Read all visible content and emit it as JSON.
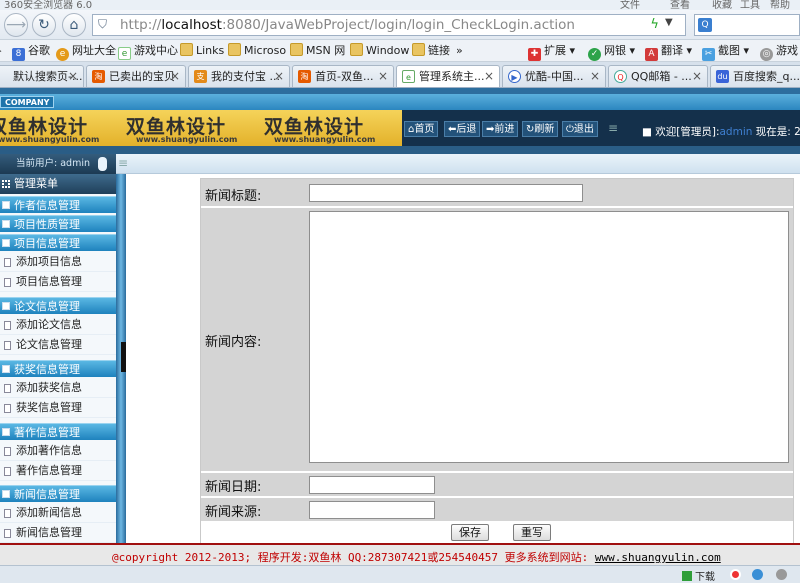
{
  "browser": {
    "title": "360安全浏览器 6.0",
    "title_menu": [
      "文件",
      "查看",
      "收藏",
      "工具",
      "帮助"
    ],
    "url_prefix": "http://",
    "url_host": "localhost",
    "url_rest": ":8080/JavaWebProject/login/login_CheckLogin.action",
    "favorites": [
      {
        "label": "谷歌"
      },
      {
        "label": "网址大全"
      },
      {
        "label": "游戏中心"
      },
      {
        "label": "Links"
      },
      {
        "label": "Microso"
      },
      {
        "label": "MSN 网"
      },
      {
        "label": "Window"
      },
      {
        "label": "链接"
      },
      {
        "label": "»"
      },
      {
        "label": "扩展"
      },
      {
        "label": "网银"
      },
      {
        "label": "翻译"
      },
      {
        "label": "截图"
      },
      {
        "label": "游戏"
      }
    ],
    "tabs": [
      {
        "label": "默认搜索页-..."
      },
      {
        "label": "已卖出的宝贝"
      },
      {
        "label": "我的支付宝 ..."
      },
      {
        "label": "首页-双鱼..."
      },
      {
        "label": "管理系统主..."
      },
      {
        "label": "优酷-中国..."
      },
      {
        "label": "QQ邮箱 - ..."
      },
      {
        "label": "百度搜索_q..."
      }
    ]
  },
  "app": {
    "company_tag": "COMPANY",
    "logo_cn": "双鱼林设计",
    "logo_en": "www.shuangyulin.com",
    "nav": [
      "首页",
      "后退",
      "前进",
      "刷新",
      "退出"
    ],
    "welcome_prefix": "欢迎[管理员]:",
    "welcome_user": "admin",
    "now_label": "现在是: 20",
    "current_user": "当前用户: admin",
    "menu_title": "管理菜单",
    "sections": [
      {
        "label": "作者信息管理",
        "items": []
      },
      {
        "label": "项目性质管理",
        "items": []
      },
      {
        "label": "项目信息管理",
        "items": [
          "添加项目信息",
          "项目信息管理"
        ]
      },
      {
        "label": "论文信息管理",
        "items": [
          "添加论文信息",
          "论文信息管理"
        ]
      },
      {
        "label": "获奖信息管理",
        "items": [
          "添加获奖信息",
          "获奖信息管理"
        ]
      },
      {
        "label": "著作信息管理",
        "items": [
          "添加著作信息",
          "著作信息管理"
        ]
      },
      {
        "label": "新闻信息管理",
        "items": [
          "添加新闻信息",
          "新闻信息管理"
        ]
      }
    ]
  },
  "form": {
    "title_label": "新闻标题:",
    "content_label": "新闻内容:",
    "date_label": "新闻日期:",
    "source_label": "新闻来源:",
    "title_value": "",
    "date_value": "",
    "source_value": "",
    "save_label": "保存",
    "reset_label": "重写"
  },
  "footer": {
    "text": "@copyright 2012-2013; 程序开发:双鱼林  QQ:287307421或254540457  更多系统到网站: ",
    "site": "www.shuangyulin.com"
  },
  "status": {
    "download": "下载"
  }
}
